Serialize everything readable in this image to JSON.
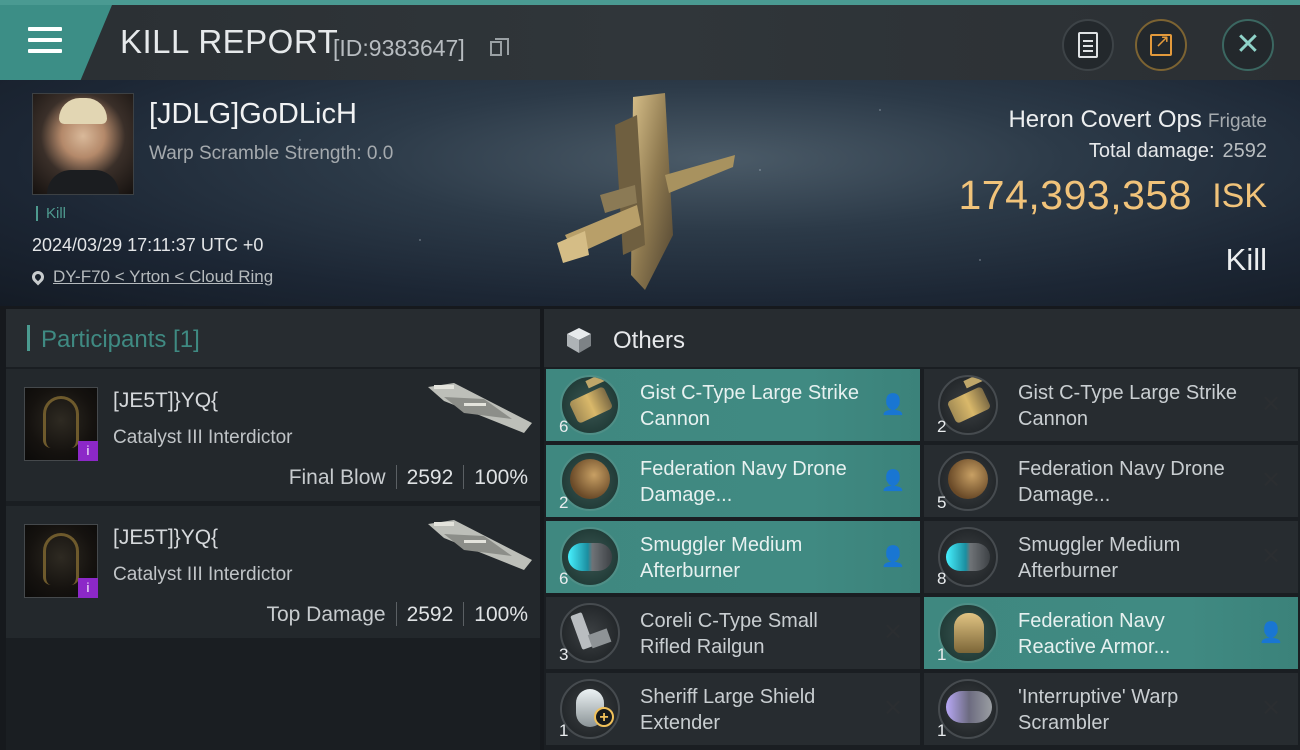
{
  "header": {
    "title": "KILL REPORT",
    "report_id": "[ID:9383647]"
  },
  "victim": {
    "name": "[JDLG]GoDLicH",
    "warp_scramble": "Warp Scramble Strength: 0.0",
    "tag": "Kill",
    "time": "2024/03/29 17:11:37 UTC +0",
    "location": "DY-F70 < Yrton < Cloud Ring",
    "ship_type": "Heron Covert Ops",
    "ship_class": "Frigate",
    "total_damage_label": "Total damage:",
    "total_damage_value": "2592",
    "isk_value": "174,393,358",
    "isk_unit": "ISK",
    "result": "Kill"
  },
  "participants": {
    "title": "Participants [1]",
    "cards": [
      {
        "name": "[JE5T]}YQ{",
        "ship": "Catalyst III Interdictor",
        "label": "Final Blow",
        "damage": "2592",
        "percent": "100%",
        "badge": "i"
      },
      {
        "name": "[JE5T]}YQ{",
        "ship": "Catalyst III Interdictor",
        "label": "Top Damage",
        "damage": "2592",
        "percent": "100%",
        "badge": "i"
      }
    ]
  },
  "others": {
    "title": "Others",
    "modules": [
      {
        "name": "Gist C-Type Large Strike Cannon",
        "qty": "6",
        "state": "dropped",
        "icon": "cannon-icon"
      },
      {
        "name": "Gist C-Type Large Strike Cannon",
        "qty": "2",
        "state": "destroyed",
        "icon": "cannon-icon"
      },
      {
        "name": "Federation Navy Drone Damage...",
        "qty": "2",
        "state": "dropped",
        "icon": "dish-icon"
      },
      {
        "name": "Federation Navy Drone Damage...",
        "qty": "5",
        "state": "destroyed",
        "icon": "dish-icon"
      },
      {
        "name": "Smuggler Medium Afterburner",
        "qty": "6",
        "state": "dropped",
        "icon": "afterburner-icon"
      },
      {
        "name": "Smuggler Medium Afterburner",
        "qty": "8",
        "state": "destroyed",
        "icon": "afterburner-icon"
      },
      {
        "name": "Coreli C-Type Small Rifled Railgun",
        "qty": "3",
        "state": "destroyed",
        "icon": "railgun-icon"
      },
      {
        "name": "Federation Navy Reactive Armor...",
        "qty": "1",
        "state": "dropped",
        "icon": "armor-icon"
      },
      {
        "name": "Sheriff Large Shield Extender",
        "qty": "1",
        "state": "destroyed",
        "icon": "shield-extender-icon"
      },
      {
        "name": "'Interruptive' Warp Scrambler",
        "qty": "1",
        "state": "destroyed",
        "icon": "warp-scrambler-icon"
      }
    ]
  },
  "colors": {
    "accent_teal": "#3f8880",
    "isk_gold": "#f1c37a",
    "badge_purple": "#8c28c8"
  }
}
